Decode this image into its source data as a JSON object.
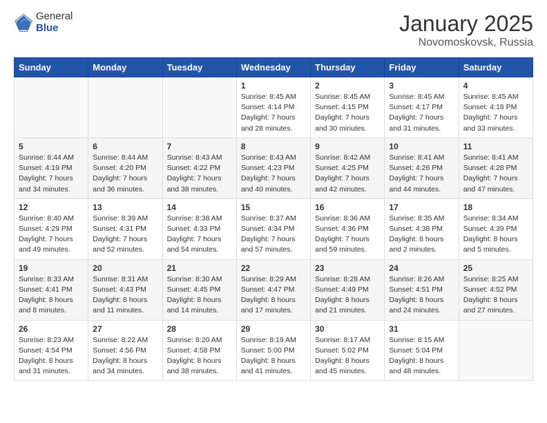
{
  "logo": {
    "general": "General",
    "blue": "Blue"
  },
  "title": {
    "month": "January 2025",
    "location": "Novomoskovsk, Russia"
  },
  "days_of_week": [
    "Sunday",
    "Monday",
    "Tuesday",
    "Wednesday",
    "Thursday",
    "Friday",
    "Saturday"
  ],
  "weeks": [
    [
      {
        "day": "",
        "info": ""
      },
      {
        "day": "",
        "info": ""
      },
      {
        "day": "",
        "info": ""
      },
      {
        "day": "1",
        "info": "Sunrise: 8:45 AM\nSunset: 4:14 PM\nDaylight: 7 hours\nand 28 minutes."
      },
      {
        "day": "2",
        "info": "Sunrise: 8:45 AM\nSunset: 4:15 PM\nDaylight: 7 hours\nand 30 minutes."
      },
      {
        "day": "3",
        "info": "Sunrise: 8:45 AM\nSunset: 4:17 PM\nDaylight: 7 hours\nand 31 minutes."
      },
      {
        "day": "4",
        "info": "Sunrise: 8:45 AM\nSunset: 4:18 PM\nDaylight: 7 hours\nand 33 minutes."
      }
    ],
    [
      {
        "day": "5",
        "info": "Sunrise: 8:44 AM\nSunset: 4:19 PM\nDaylight: 7 hours\nand 34 minutes."
      },
      {
        "day": "6",
        "info": "Sunrise: 8:44 AM\nSunset: 4:20 PM\nDaylight: 7 hours\nand 36 minutes."
      },
      {
        "day": "7",
        "info": "Sunrise: 8:43 AM\nSunset: 4:22 PM\nDaylight: 7 hours\nand 38 minutes."
      },
      {
        "day": "8",
        "info": "Sunrise: 8:43 AM\nSunset: 4:23 PM\nDaylight: 7 hours\nand 40 minutes."
      },
      {
        "day": "9",
        "info": "Sunrise: 8:42 AM\nSunset: 4:25 PM\nDaylight: 7 hours\nand 42 minutes."
      },
      {
        "day": "10",
        "info": "Sunrise: 8:41 AM\nSunset: 4:26 PM\nDaylight: 7 hours\nand 44 minutes."
      },
      {
        "day": "11",
        "info": "Sunrise: 8:41 AM\nSunset: 4:28 PM\nDaylight: 7 hours\nand 47 minutes."
      }
    ],
    [
      {
        "day": "12",
        "info": "Sunrise: 8:40 AM\nSunset: 4:29 PM\nDaylight: 7 hours\nand 49 minutes."
      },
      {
        "day": "13",
        "info": "Sunrise: 8:39 AM\nSunset: 4:31 PM\nDaylight: 7 hours\nand 52 minutes."
      },
      {
        "day": "14",
        "info": "Sunrise: 8:38 AM\nSunset: 4:33 PM\nDaylight: 7 hours\nand 54 minutes."
      },
      {
        "day": "15",
        "info": "Sunrise: 8:37 AM\nSunset: 4:34 PM\nDaylight: 7 hours\nand 57 minutes."
      },
      {
        "day": "16",
        "info": "Sunrise: 8:36 AM\nSunset: 4:36 PM\nDaylight: 7 hours\nand 59 minutes."
      },
      {
        "day": "17",
        "info": "Sunrise: 8:35 AM\nSunset: 4:38 PM\nDaylight: 8 hours\nand 2 minutes."
      },
      {
        "day": "18",
        "info": "Sunrise: 8:34 AM\nSunset: 4:39 PM\nDaylight: 8 hours\nand 5 minutes."
      }
    ],
    [
      {
        "day": "19",
        "info": "Sunrise: 8:33 AM\nSunset: 4:41 PM\nDaylight: 8 hours\nand 8 minutes."
      },
      {
        "day": "20",
        "info": "Sunrise: 8:31 AM\nSunset: 4:43 PM\nDaylight: 8 hours\nand 11 minutes."
      },
      {
        "day": "21",
        "info": "Sunrise: 8:30 AM\nSunset: 4:45 PM\nDaylight: 8 hours\nand 14 minutes."
      },
      {
        "day": "22",
        "info": "Sunrise: 8:29 AM\nSunset: 4:47 PM\nDaylight: 8 hours\nand 17 minutes."
      },
      {
        "day": "23",
        "info": "Sunrise: 8:28 AM\nSunset: 4:49 PM\nDaylight: 8 hours\nand 21 minutes."
      },
      {
        "day": "24",
        "info": "Sunrise: 8:26 AM\nSunset: 4:51 PM\nDaylight: 8 hours\nand 24 minutes."
      },
      {
        "day": "25",
        "info": "Sunrise: 8:25 AM\nSunset: 4:52 PM\nDaylight: 8 hours\nand 27 minutes."
      }
    ],
    [
      {
        "day": "26",
        "info": "Sunrise: 8:23 AM\nSunset: 4:54 PM\nDaylight: 8 hours\nand 31 minutes."
      },
      {
        "day": "27",
        "info": "Sunrise: 8:22 AM\nSunset: 4:56 PM\nDaylight: 8 hours\nand 34 minutes."
      },
      {
        "day": "28",
        "info": "Sunrise: 8:20 AM\nSunset: 4:58 PM\nDaylight: 8 hours\nand 38 minutes."
      },
      {
        "day": "29",
        "info": "Sunrise: 8:19 AM\nSunset: 5:00 PM\nDaylight: 8 hours\nand 41 minutes."
      },
      {
        "day": "30",
        "info": "Sunrise: 8:17 AM\nSunset: 5:02 PM\nDaylight: 8 hours\nand 45 minutes."
      },
      {
        "day": "31",
        "info": "Sunrise: 8:15 AM\nSunset: 5:04 PM\nDaylight: 8 hours\nand 48 minutes."
      },
      {
        "day": "",
        "info": ""
      }
    ]
  ]
}
